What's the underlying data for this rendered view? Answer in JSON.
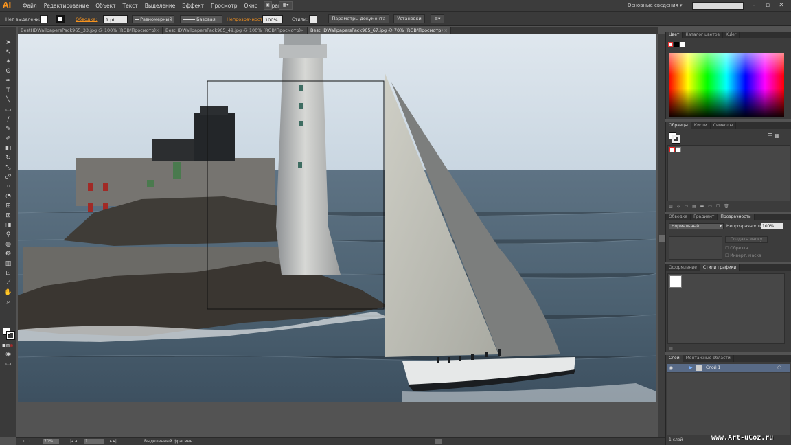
{
  "app": {
    "logo": "Ai"
  },
  "menu": {
    "items": [
      "Файл",
      "Редактирование",
      "Объект",
      "Текст",
      "Выделение",
      "Эффект",
      "Просмотр",
      "Окно",
      "Справка"
    ]
  },
  "workspace": {
    "label": "Основные сведения"
  },
  "control_bar": {
    "selection_label": "Нет выделения",
    "stroke_label": "Обводка:",
    "stroke_weight": "1 pt",
    "profile_label": "Равномерный",
    "brush_label": "Базовая",
    "opacity_label": "Непрозрачность:",
    "opacity_value": "100%",
    "styles_label": "Стили:",
    "doc_settings_button": "Параметры документа",
    "preferences_button": "Установки"
  },
  "document_tabs": [
    {
      "label": "BestHDWallpapersPack965_33.jpg @ 100% (RGB/Просмотр)",
      "close": "×"
    },
    {
      "label": "BestHDWallpapersPack965_49.jpg @ 100% (RGB/Просмотр)",
      "close": "×"
    },
    {
      "label": "BestHDWallpapersPack965_67.jpg @ 70% (RGB/Просмотр)",
      "close": "×"
    }
  ],
  "status_bar": {
    "zoom": "70%",
    "page": "1",
    "status_text": "Выделенный фрагмент"
  },
  "panels": {
    "color": {
      "tabs": [
        "Цвет",
        "Каталог цветов",
        "Kuler"
      ]
    },
    "swatches": {
      "tabs": [
        "Образцы",
        "Кисти",
        "Символы"
      ]
    },
    "transparency": {
      "tabs": [
        "Обводка",
        "Градиент",
        "Прозрачность"
      ],
      "blend_mode": "Нормальный",
      "opacity_label": "Непрозрачность:",
      "opacity_value": "100%",
      "make_mask_button": "Создать маску",
      "clip_label": "Обрезка",
      "invert_label": "Инверт. маска"
    },
    "graphic_styles": {
      "tabs": [
        "Оформление",
        "Стили графики"
      ]
    },
    "layers": {
      "tabs": [
        "Слои",
        "Монтажные области"
      ],
      "layer_name": "Слой 1",
      "footer": "1 слой"
    }
  },
  "watermark": "www.Art-uCoz.ru",
  "colors": {
    "accent": "#f7931e",
    "panel_bg": "#3c3c3c",
    "canvas_bg": "#535353"
  }
}
